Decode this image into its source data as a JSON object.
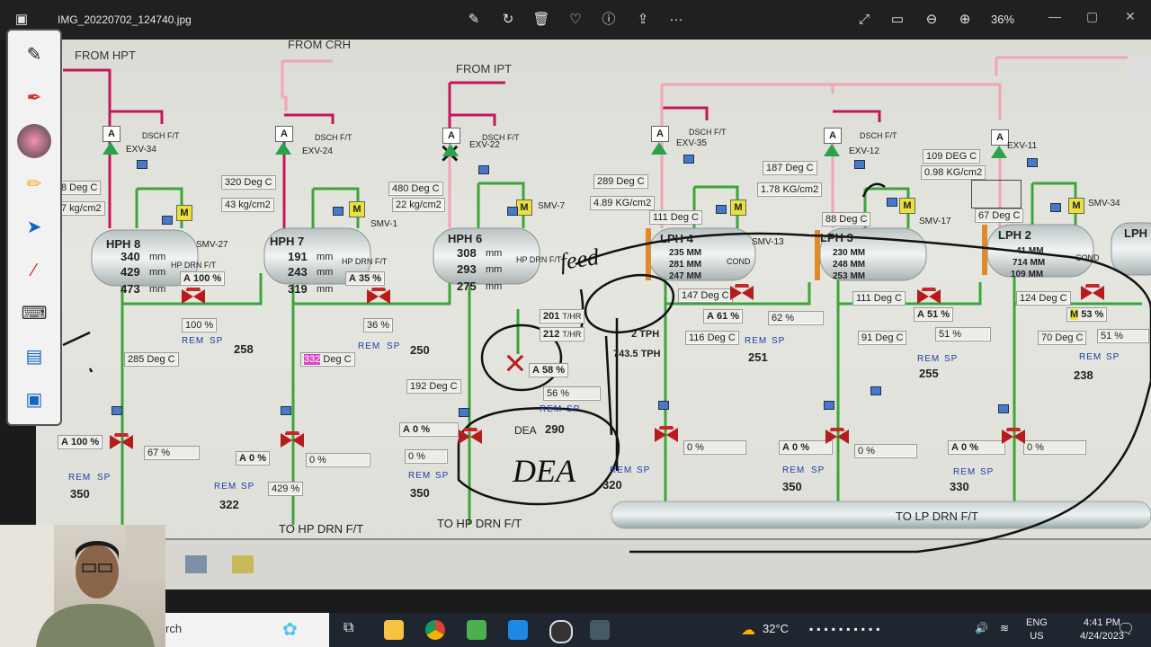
{
  "titlebar": {
    "filename": "IMG_20220702_124740.jpg",
    "zoom": "36%",
    "icons": [
      "photo-icon",
      "edit-icon",
      "rotate-icon",
      "delete-icon",
      "favorite-icon",
      "info-icon",
      "share-icon",
      "more-icon",
      "fullscreen-icon",
      "fit-icon",
      "zoom-out-icon",
      "zoom-in-icon",
      "minimize-icon",
      "maximize-icon",
      "close-icon"
    ]
  },
  "scada": {
    "headers": {
      "from_hpt": "FROM HPT",
      "from_crh": "FROM CRH",
      "from_ipt": "FROM IPT"
    },
    "heaters": {
      "hph8": "HPH 8",
      "hph7": "HPH 7",
      "hph6": "HPH 6",
      "lph4": "LPH 4",
      "lph3": "LPH 3",
      "lph2": "LPH 2",
      "lph1": "LPH"
    },
    "valves": {
      "exv34": "EXV-34",
      "exv24": "EXV-24",
      "exv22": "EXV-22",
      "exv35": "EXV-35",
      "exv12": "EXV-12",
      "exv11": "EXV-11",
      "smv27": "SMV-27",
      "smv1": "SMV-1",
      "smv7": "SMV-7",
      "smv17": "SMV-17",
      "smv34": "SMV-34",
      "smv13": "SMV-13"
    },
    "dsch": "DSCH F/T",
    "hp_drn": "HP DRN F/T",
    "cond": "COND",
    "rem": "REM",
    "sp": "SP",
    "deaerator": "DEA",
    "to_hp_drn_1": "TO HP DRN F/T",
    "to_hp_drn_2": "TO HP DRN F/T",
    "to_lp_drn": "TO LP DRN F/T",
    "hph8_vals": {
      "t1": "8 Deg C",
      "p1": "7 kg/cm2",
      "l1": "340",
      "l2": "429",
      "l3": "473",
      "u": "mm",
      "a": "A",
      "pct": "100 %",
      "out": "100 %",
      "t2": "285 Deg C",
      "sp": "258",
      "pct2": "100 %",
      "pct3": "67 %",
      "sp2": "350"
    },
    "hph7_vals": {
      "t1": "320 Deg C",
      "p1": "43 kg/cm2",
      "l1": "191",
      "l2": "243",
      "l3": "319",
      "pct": "35 %",
      "out": "36 %",
      "t2": "332",
      "t2u": "Deg C",
      "sp": "250",
      "pct2": "0 %",
      "pct3": "0 %",
      "pct4": "429 %",
      "sp2": "322"
    },
    "hph6_vals": {
      "t1": "480 Deg C",
      "p1": "22 kg/cm2",
      "l1": "308",
      "l2": "293",
      "l3": "275",
      "t2": "192 Deg C",
      "pct2": "0 %",
      "pct3": "0 %",
      "sp2": "350"
    },
    "dea_vals": {
      "t1": "201",
      "t1u": "T/HR",
      "t2": "212",
      "t2u": "T/HR",
      "f1": "2 TPH",
      "f2": "743.5 TPH",
      "pct": "58 %",
      "out": "56 %",
      "sp": "290",
      "sp2": "320"
    },
    "lph4_vals": {
      "t1": "289 Deg C",
      "p1": "4.89 KG/cm2",
      "t2": "111 Deg C",
      "l1": "235 MM",
      "l2": "281 MM",
      "l3": "247 MM",
      "t3": "147 Deg C",
      "pct": "61 %",
      "out": "62 %",
      "t4": "116 Deg C",
      "sp": "251",
      "pct2": "0 %"
    },
    "lph3_vals": {
      "t1": "187 Deg C",
      "p1": "1.78 KG/cm2",
      "t2": "88 Deg C",
      "l1": "230 MM",
      "l2": "248 MM",
      "l3": "253 MM",
      "t3": "111 Deg C",
      "t4": "91 Deg C",
      "sp": "255",
      "pct2": "0 %",
      "pct3": "0 %",
      "sp2": "350"
    },
    "lph2_vals": {
      "t1": "109 DEG C",
      "p1": "0.98 KG/cm2",
      "t2": "67 Deg C",
      "l1": "41 MM",
      "l2": "714 MM",
      "l3": "109 MM",
      "t3": "124 Deg C",
      "pct": "51 %",
      "out": "51 %",
      "pct_m": "53 %",
      "out2": "51 %",
      "t4": "70 Deg C",
      "sp": "238",
      "pct2": "0 %",
      "pct3": "0 %",
      "sp2": "330",
      "m": "M"
    }
  },
  "handwriting": {
    "feed": "feed",
    "dea_big": "DEA",
    "mark": "×"
  },
  "taskbar": {
    "search": "rch",
    "weather": "32°C",
    "lang1": "ENG",
    "lang2": "US",
    "time": "4:41 PM",
    "date": "4/24/2023"
  }
}
